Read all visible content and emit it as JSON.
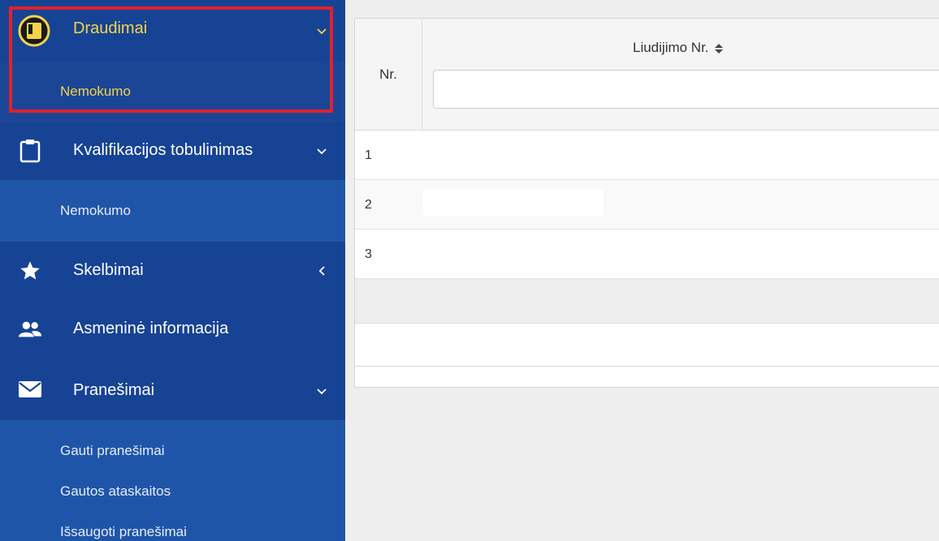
{
  "sidebar": {
    "items": [
      {
        "label": "Draudimai",
        "icon": "book-icon",
        "chevron": "down"
      },
      {
        "label": "Kvalifikacijos tobulinimas",
        "icon": "clipboard-icon",
        "chevron": "down"
      },
      {
        "label": "Skelbimai",
        "icon": "star-icon",
        "chevron": "left"
      },
      {
        "label": "Asmeninė informacija",
        "icon": "users-icon",
        "chevron": ""
      },
      {
        "label": "Pranešimai",
        "icon": "envelope-icon",
        "chevron": "down"
      }
    ],
    "subitems": {
      "draudimai": [
        "Nemokumo"
      ],
      "kvalifikacija": [
        "Nemokumo"
      ],
      "pranesimai": [
        "Gauti pranešimai",
        "Gautos ataskaitos",
        "Išsaugoti pranešimai"
      ]
    },
    "colors": {
      "accent": "#f6d34a",
      "highlight": "#e3202e",
      "background": "#1e4f9f"
    }
  },
  "table": {
    "columns": {
      "nr": "Nr.",
      "liudijimo": "Liudijimo Nr."
    },
    "filter_value": "",
    "rows": [
      {
        "nr": "1"
      },
      {
        "nr": "2"
      },
      {
        "nr": "3"
      }
    ]
  }
}
